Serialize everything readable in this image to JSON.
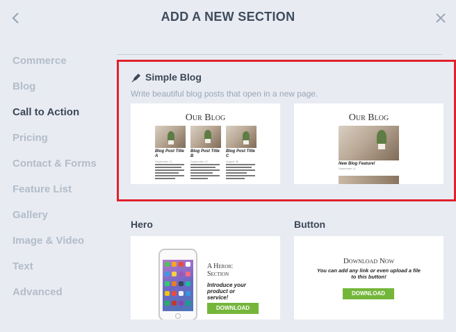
{
  "header": {
    "title": "ADD A NEW SECTION"
  },
  "sidebar": {
    "items": [
      {
        "label": "Commerce",
        "active": false
      },
      {
        "label": "Blog",
        "active": false
      },
      {
        "label": "Call to Action",
        "active": true
      },
      {
        "label": "Pricing",
        "active": false
      },
      {
        "label": "Contact & Forms",
        "active": false
      },
      {
        "label": "Feature List",
        "active": false
      },
      {
        "label": "Gallery",
        "active": false
      },
      {
        "label": "Image & Video",
        "active": false
      },
      {
        "label": "Text",
        "active": false
      },
      {
        "label": "Advanced",
        "active": false
      }
    ]
  },
  "simple_blog": {
    "title": "Simple Blog",
    "description": "Write beautiful blog posts that open in a new page.",
    "thumb1": {
      "heading": "Our Blog",
      "posts": [
        {
          "title": "Blog Post Title A",
          "date": "September 11"
        },
        {
          "title": "Blog Post Title B",
          "date": "September 12"
        },
        {
          "title": "Blog Post Title C",
          "date": "August 30"
        }
      ]
    },
    "thumb2": {
      "heading": "Our Blog",
      "post_title": "New Blog Feature!",
      "post_date": "September 11"
    }
  },
  "hero": {
    "title": "Hero",
    "thumb": {
      "heading": "A Heroic Section",
      "tagline": "Introduce your product or service!",
      "button": "DOWNLOAD"
    }
  },
  "button_section": {
    "title": "Button",
    "thumb": {
      "heading": "Download Now",
      "tagline": "You can add any link or even upload a file to this button!",
      "button": "DOWNLOAD"
    }
  },
  "colors": {
    "highlight": "#e0202b",
    "accent_green": "#74b63a",
    "background": "#e8ecf2"
  },
  "icons": [
    "back-chevron-icon",
    "close-icon",
    "pen-nib-icon"
  ]
}
